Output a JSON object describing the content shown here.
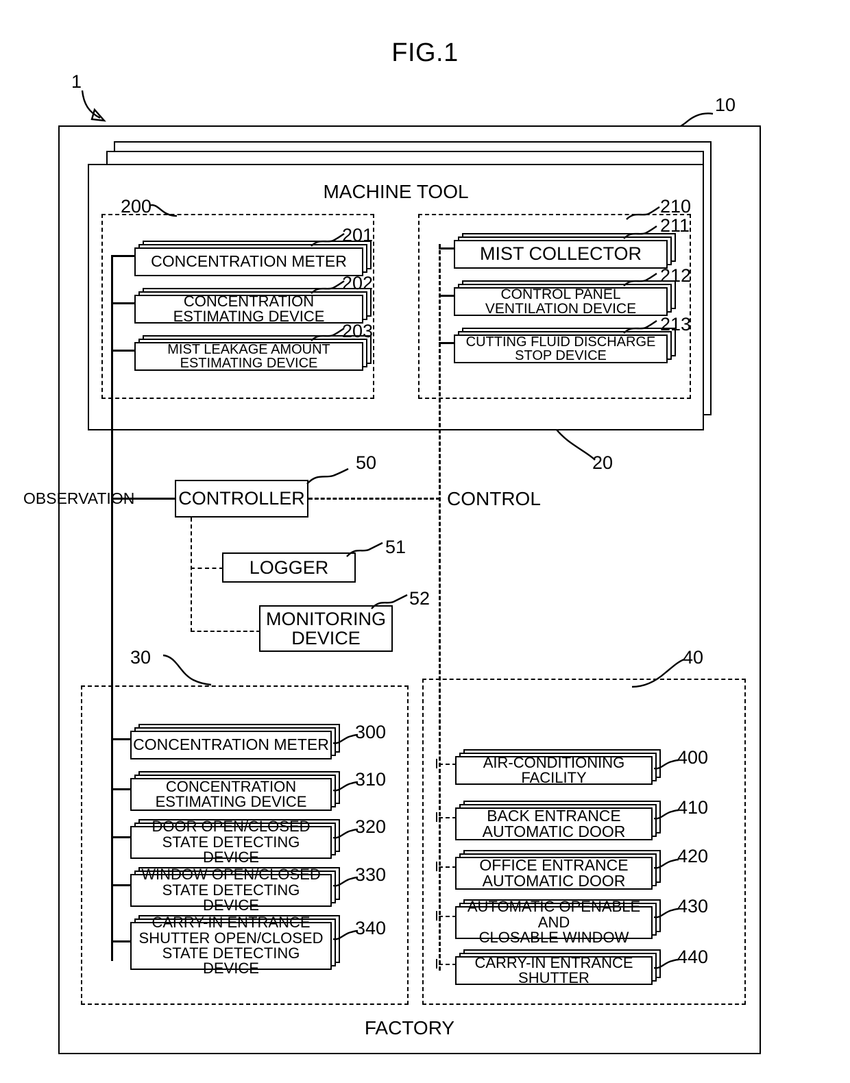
{
  "figure": {
    "title": "FIG.1",
    "system_ref": "1",
    "factory_ref": "10",
    "factory_label": "FACTORY",
    "machine_tool_label": "MACHINE TOOL",
    "machine_tool_ref": "20",
    "observation_label": "OBSERVATION",
    "control_label": "CONTROL"
  },
  "machine_tool": {
    "observation_group": {
      "ref": "200",
      "items": [
        {
          "ref": "201",
          "label": "CONCENTRATION METER",
          "font": 23
        },
        {
          "ref": "202",
          "label": "CONCENTRATION ESTIMATING DEVICE",
          "font": 22
        },
        {
          "ref": "203",
          "label": "MIST LEAKAGE AMOUNT ESTIMATING DEVICE",
          "font": 20
        }
      ]
    },
    "control_group": {
      "ref": "210",
      "items": [
        {
          "ref": "211",
          "label": "MIST COLLECTOR",
          "font": 27
        },
        {
          "ref": "212",
          "label": "CONTROL PANEL VENTILATION DEVICE",
          "font": 21
        },
        {
          "ref": "213",
          "label": "CUTTING FLUID DISCHARGE STOP DEVICE",
          "font": 20
        }
      ]
    }
  },
  "middle": {
    "controller": {
      "ref": "50",
      "label": "CONTROLLER"
    },
    "logger": {
      "ref": "51",
      "label": "LOGGER"
    },
    "monitoring_device": {
      "ref": "52",
      "label": "MONITORING\nDEVICE",
      "line1": "MONITORING",
      "line2": "DEVICE"
    }
  },
  "factory": {
    "observation_group": {
      "ref": "30",
      "items": [
        {
          "ref": "300",
          "lines": [
            "CONCENTRATION METER"
          ],
          "font": 23
        },
        {
          "ref": "310",
          "lines": [
            "CONCENTRATION",
            "ESTIMATING DEVICE"
          ],
          "font": 22
        },
        {
          "ref": "320",
          "lines": [
            "DOOR OPEN/CLOSED",
            "STATE DETECTING DEVICE"
          ],
          "font": 22
        },
        {
          "ref": "330",
          "lines": [
            "WINDOW OPEN/CLOSED",
            "STATE DETECTING DEVICE"
          ],
          "font": 22
        },
        {
          "ref": "340",
          "lines": [
            "CARRY-IN ENTRANCE",
            "SHUTTER OPEN/CLOSED",
            "STATE DETECTING DEVICE"
          ],
          "font": 22
        }
      ]
    },
    "control_group": {
      "ref": "40",
      "items": [
        {
          "ref": "400",
          "lines": [
            "AIR-CONDITIONING FACILITY"
          ],
          "font": 22
        },
        {
          "ref": "410",
          "lines": [
            "BACK ENTRANCE",
            "AUTOMATIC DOOR"
          ],
          "font": 23
        },
        {
          "ref": "420",
          "lines": [
            "OFFICE ENTRANCE",
            "AUTOMATIC DOOR"
          ],
          "font": 23
        },
        {
          "ref": "430",
          "lines": [
            "AUTOMATIC OPENABLE AND",
            "CLOSABLE WINDOW"
          ],
          "font": 22
        },
        {
          "ref": "440",
          "lines": [
            "CARRY-IN ENTRANCE SHUTTER"
          ],
          "font": 22
        }
      ]
    }
  }
}
